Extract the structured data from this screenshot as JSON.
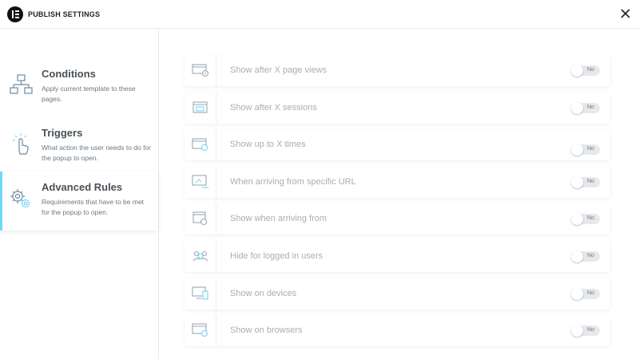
{
  "header": {
    "title": "PUBLISH SETTINGS",
    "logo_icon": "elementor-logo",
    "close_icon": "close-icon"
  },
  "sidebar": {
    "items": [
      {
        "title": "Conditions",
        "description": "Apply current template to these pages.",
        "icon": "sitemap-icon",
        "active": false
      },
      {
        "title": "Triggers",
        "description": "What action the user needs to do for the popup to open.",
        "icon": "pointer-icon",
        "active": false
      },
      {
        "title": "Advanced Rules",
        "description": "Requirements that have to be met for the popup to open.",
        "icon": "gears-icon",
        "active": true
      }
    ],
    "accent_color": "#71d7f7"
  },
  "rules": [
    {
      "label": "Show after X page views",
      "toggle": "No",
      "icon": "page-views-icon"
    },
    {
      "label": "Show after X sessions",
      "toggle": "No",
      "icon": "sessions-icon"
    },
    {
      "label": "Show up to X times",
      "toggle": "No",
      "icon": "times-icon"
    },
    {
      "label": "When arriving from specific URL",
      "toggle": "No",
      "icon": "url-icon"
    },
    {
      "label": "Show when arriving from",
      "toggle": "No",
      "icon": "arriving-from-icon"
    },
    {
      "label": "Hide for logged in users",
      "toggle": "No",
      "icon": "users-icon"
    },
    {
      "label": "Show on devices",
      "toggle": "No",
      "icon": "devices-icon"
    },
    {
      "label": "Show on browsers",
      "toggle": "No",
      "icon": "browsers-icon"
    }
  ]
}
